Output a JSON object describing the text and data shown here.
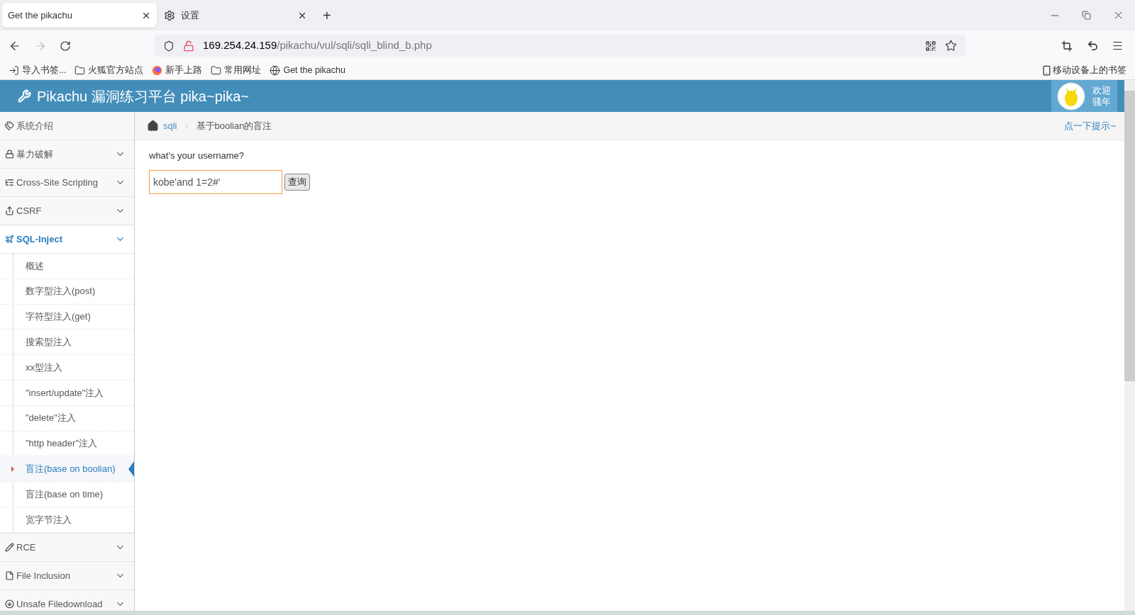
{
  "browser": {
    "tabs": [
      {
        "title": "Get the pikachu",
        "selected": true,
        "kind": "page"
      },
      {
        "title": "设置",
        "selected": false,
        "kind": "settings"
      }
    ],
    "new_tab": "+",
    "address": {
      "host": "169.254.24.159",
      "path": "/pikachu/vul/sqli/sqli_blind_b.php"
    },
    "bookmarks": [
      {
        "label": "导入书签...",
        "kind": "import"
      },
      {
        "label": "火狐官方站点",
        "kind": "folder"
      },
      {
        "label": "新手上路",
        "kind": "firefox"
      },
      {
        "label": "常用网址",
        "kind": "folder"
      },
      {
        "label": "Get the pikachu",
        "kind": "globe"
      }
    ],
    "mobile_bookmarks": "移动设备上的书签"
  },
  "header": {
    "brand": "Pikachu 漏洞练习平台 pika~pika~",
    "greeting": [
      "欢迎",
      "骚年"
    ]
  },
  "sidebar": {
    "items": [
      {
        "label": "系统介绍",
        "selected": false
      },
      {
        "label": "暴力破解",
        "expanded": false,
        "selected": false
      },
      {
        "label": "Cross-Site Scripting",
        "expanded": false,
        "selected": false
      },
      {
        "label": "CSRF",
        "expanded": false,
        "selected": false
      },
      {
        "label": "SQL-Inject",
        "expanded": true,
        "selected": true,
        "children": [
          {
            "label": "概述",
            "selected": false
          },
          {
            "label": "数字型注入(post)",
            "selected": false
          },
          {
            "label": "字符型注入(get)",
            "selected": false
          },
          {
            "label": "搜索型注入",
            "selected": false
          },
          {
            "label": "xx型注入",
            "selected": false
          },
          {
            "label": "\"insert/update\"注入",
            "selected": false
          },
          {
            "label": "\"delete\"注入",
            "selected": false
          },
          {
            "label": "\"http header\"注入",
            "selected": false
          },
          {
            "label": "盲注(base on boolian)",
            "selected": true
          },
          {
            "label": "盲注(base on time)",
            "selected": false
          },
          {
            "label": "宽字节注入",
            "selected": false
          }
        ]
      },
      {
        "label": "RCE",
        "expanded": false,
        "selected": false
      },
      {
        "label": "File Inclusion",
        "expanded": false,
        "selected": false
      },
      {
        "label": "Unsafe Filedownload",
        "expanded": false,
        "selected": false
      }
    ]
  },
  "breadcrumb": {
    "section": "sqli",
    "current": "基于boolian的盲注",
    "hint": "点一下提示~"
  },
  "form": {
    "label": "what's your username?",
    "value": "kobe'and 1=2#'",
    "button": "查询"
  }
}
